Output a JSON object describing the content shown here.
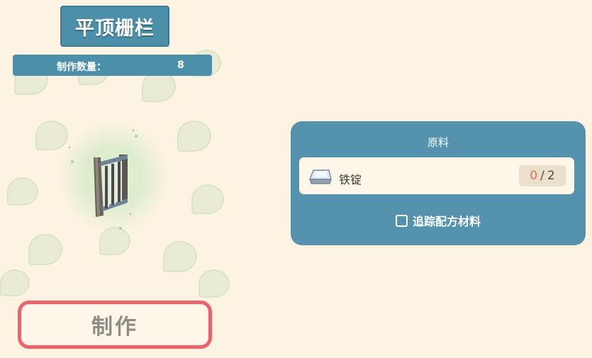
{
  "item": {
    "name": "平顶栅栏",
    "icon": "fence-icon"
  },
  "quantity": {
    "label": "制作数量：",
    "value": "8"
  },
  "craft_button": {
    "label": "制作"
  },
  "recipe": {
    "title": "原料",
    "ingredients": [
      {
        "name": "铁锭",
        "icon": "iron-ingot-icon",
        "have": "0",
        "separator": "/",
        "need": "2"
      }
    ],
    "track_label": "追踪配方材料"
  },
  "colors": {
    "background": "#fdf3e2",
    "panel": "#5592ad",
    "title_plate": "#4b8fa9",
    "craft_border": "#f0626a",
    "count_have": "#f06a56"
  }
}
